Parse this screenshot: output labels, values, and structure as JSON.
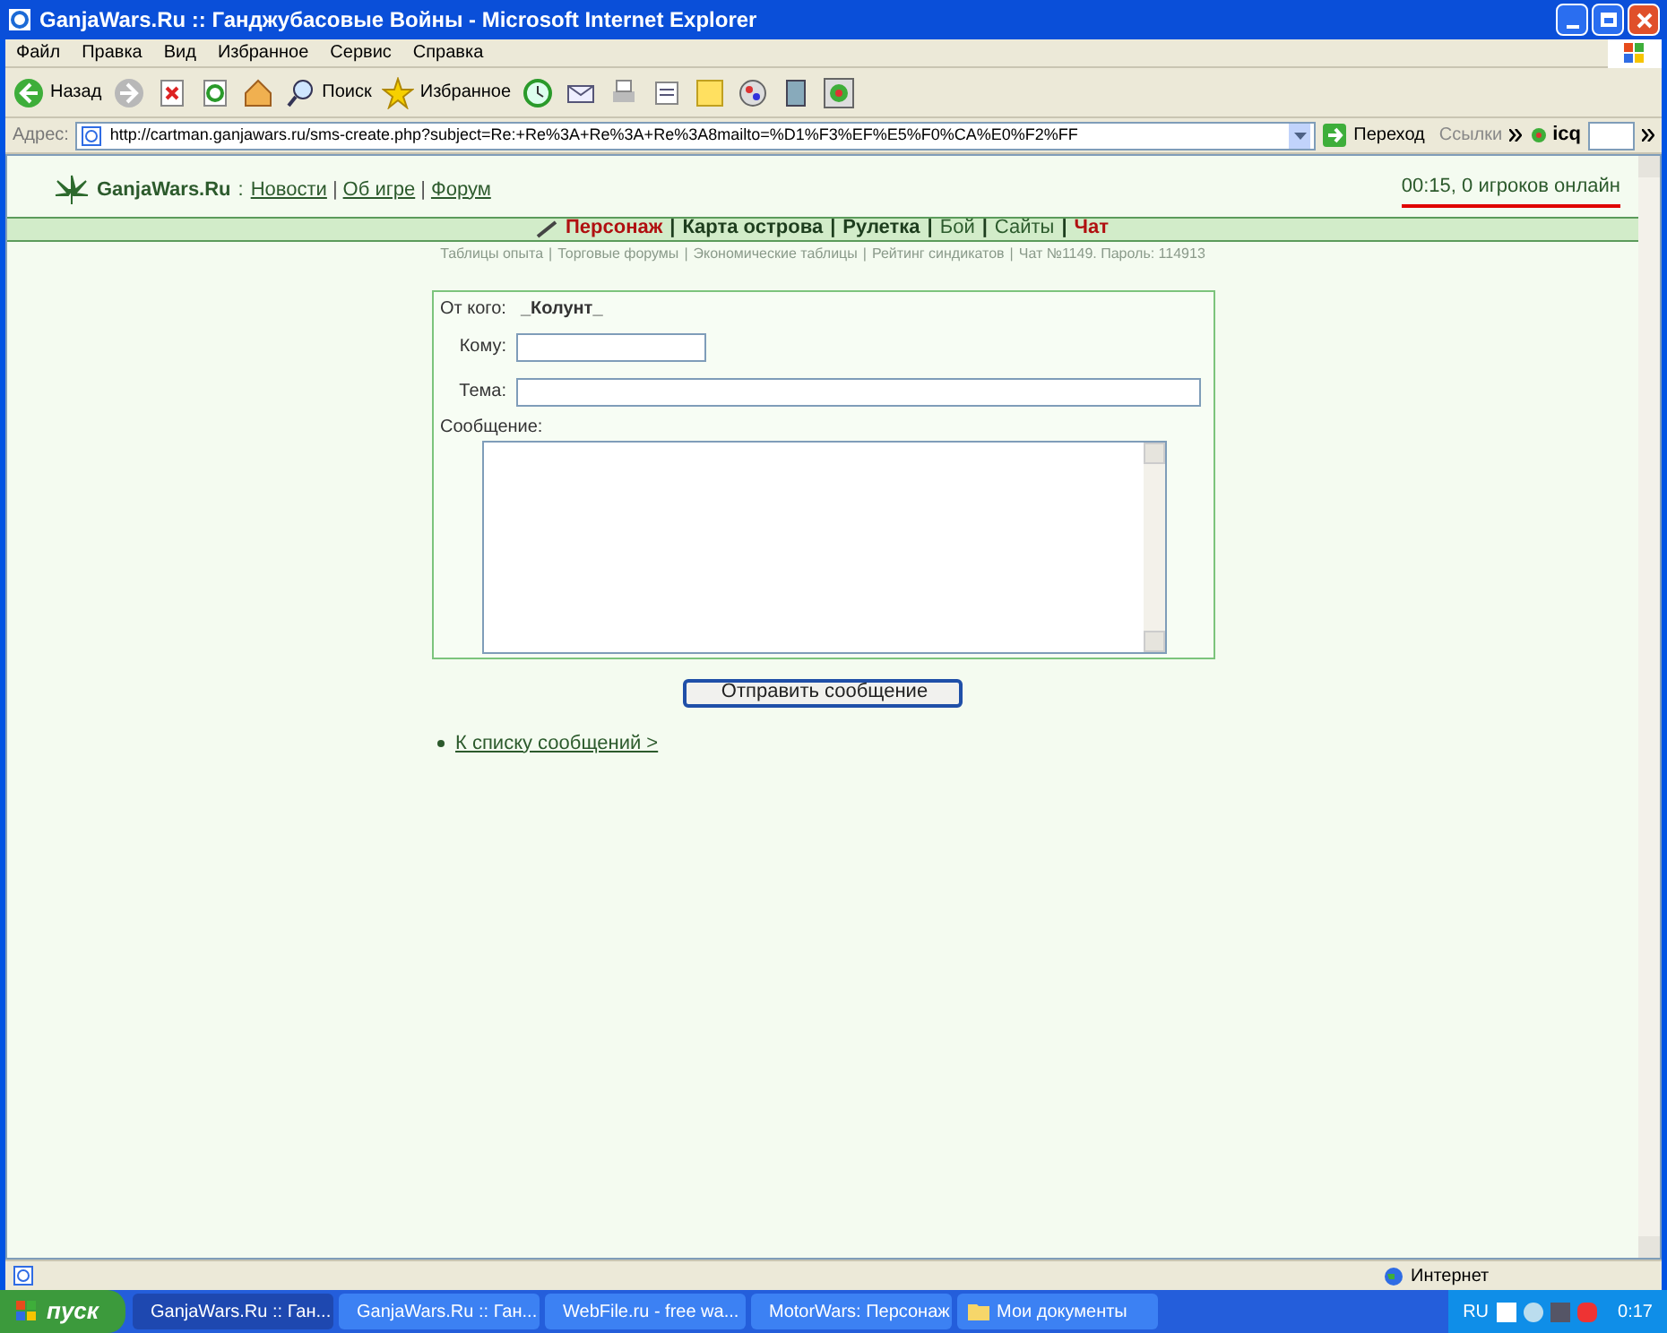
{
  "window": {
    "title": "GanjaWars.Ru :: Ганджубасовые Войны - Microsoft Internet Explorer"
  },
  "menu": [
    "Файл",
    "Правка",
    "Вид",
    "Избранное",
    "Сервис",
    "Справка"
  ],
  "toolbar": [
    {
      "kind": "back",
      "label": "Назад"
    },
    {
      "kind": "forward"
    },
    {
      "kind": "stop"
    },
    {
      "kind": "refresh"
    },
    {
      "kind": "home"
    },
    {
      "kind": "search",
      "label": "Поиск"
    },
    {
      "kind": "favorites",
      "label": "Избранное"
    },
    {
      "kind": "history"
    },
    {
      "kind": "mail"
    },
    {
      "kind": "print"
    },
    {
      "kind": "edit"
    },
    {
      "kind": "note"
    },
    {
      "kind": "paint"
    },
    {
      "kind": "tool"
    },
    {
      "kind": "flower"
    }
  ],
  "address": {
    "label": "Адрес:",
    "url": "http://cartman.ganjawars.ru/sms-create.php?subject=Re:+Re%3A+Re%3A+Re%3A8mailto=%D1%F3%EF%E5%F0%CA%E0%F2%FF",
    "go": "Переход",
    "links": "Ссылки",
    "icq": "icq"
  },
  "header": {
    "logo": "GanjaWars.Ru",
    "separator": ":",
    "link_separator": "|",
    "links": [
      "Новости",
      "Об игре",
      "Форум"
    ],
    "online": "00:15, 0 игроков онлайн"
  },
  "nav_separator": "|",
  "main_nav": [
    {
      "label": "Персонаж",
      "kind": "accent"
    },
    {
      "label": "Карта острова",
      "kind": "bold"
    },
    {
      "label": "Рулетка",
      "kind": "bold"
    },
    {
      "label": "Бой",
      "kind": "plain"
    },
    {
      "label": "Сайты",
      "kind": "plain"
    },
    {
      "label": "Чат",
      "kind": "accent"
    }
  ],
  "sub_nav": [
    "Таблицы опыта",
    "Торговые форумы",
    "Экономические таблицы",
    "Рейтинг синдикатов",
    "Чат №1149. Пароль: 114913"
  ],
  "form": {
    "from_label": "От кого:",
    "from_value": "_Колунт_",
    "to_label": "Кому:",
    "subject_label": "Тема:",
    "message_label": "Сообщение:",
    "submit": "Отправить сообщение"
  },
  "back_link": "К списку сообщений >",
  "status_bar": {
    "zone": "Интернет"
  },
  "taskbar": {
    "start": "пуск",
    "tasks": [
      {
        "label": "GanjaWars.Ru :: Ган...",
        "selected": true
      },
      {
        "label": "GanjaWars.Ru :: Ган...",
        "selected": false
      },
      {
        "label": "WebFile.ru - free wa...",
        "selected": false
      },
      {
        "label": "MotorWars: Персонаж",
        "selected": false
      },
      {
        "label": "Мои документы",
        "selected": false
      }
    ],
    "lang": "RU",
    "clock": "0:17"
  }
}
